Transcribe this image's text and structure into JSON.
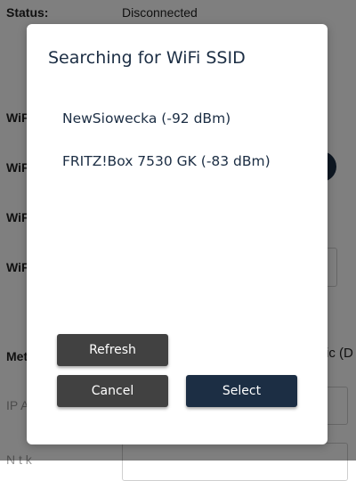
{
  "background": {
    "status_label": "Status:",
    "status_value": "Disconnected",
    "truncated_labels": [
      "WiF",
      "WiF",
      "WiF",
      "WiF"
    ],
    "method_label": "Met",
    "method_value": "ic (D",
    "ip_placeholder": "IP A",
    "netmask_placeholder": "N  t  k"
  },
  "dialog": {
    "title": "Searching for WiFi SSID",
    "networks": [
      {
        "label": "NewSiowecka (-92 dBm)"
      },
      {
        "label": "FRITZ!Box 7530 GK (-83 dBm)"
      }
    ],
    "buttons": {
      "refresh": "Refresh",
      "cancel": "Cancel",
      "select": "Select"
    }
  },
  "colors": {
    "primary": "#1c2e44",
    "secondary_button": "#414141",
    "overlay": "rgba(0,0,0,0.5)"
  }
}
